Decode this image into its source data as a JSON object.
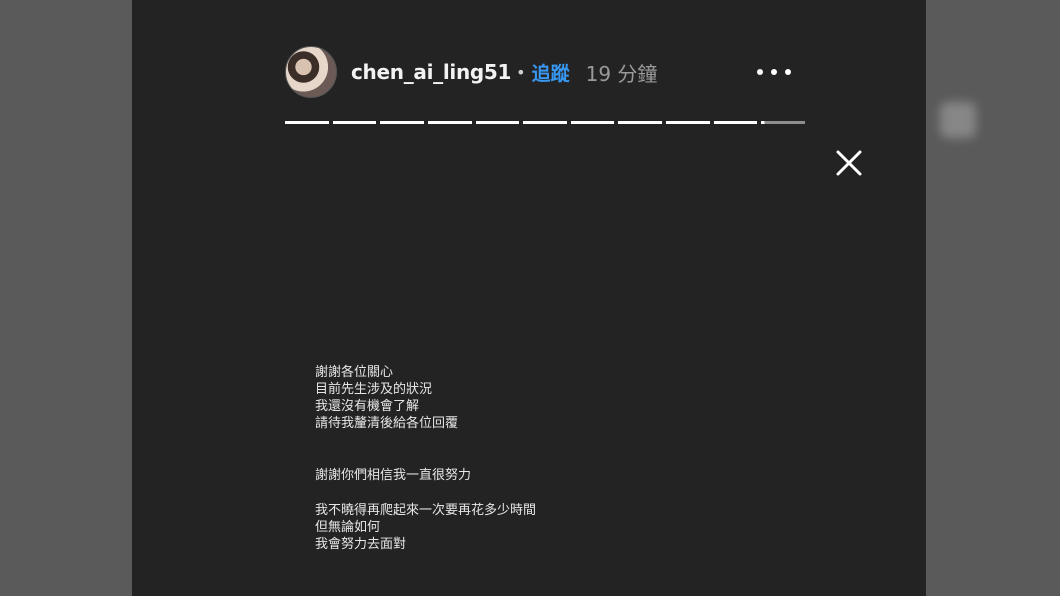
{
  "story": {
    "username": "chen_ai_ling51",
    "separator": "•",
    "follow_label": "追蹤",
    "time_ago": "19 分鐘",
    "progress": {
      "segments": 11,
      "completed": 10,
      "current_fraction": 0.08
    }
  },
  "icons": {
    "more": "more-options-icon",
    "close": "close-icon",
    "avatar": "avatar"
  },
  "colors": {
    "follow": "#3897f0",
    "story_bg": "#232323",
    "backdrop": "#5a5a5a"
  },
  "message": {
    "lines": [
      "謝謝各位關心",
      "目前先生涉及的狀況",
      "我還沒有機會了解",
      "請待我釐清後給各位回覆",
      "謝謝你們相信我一直很努力",
      "我不曉得再爬起來一次要再花多少時間",
      "但無論如何",
      "我會努力去面對"
    ]
  }
}
